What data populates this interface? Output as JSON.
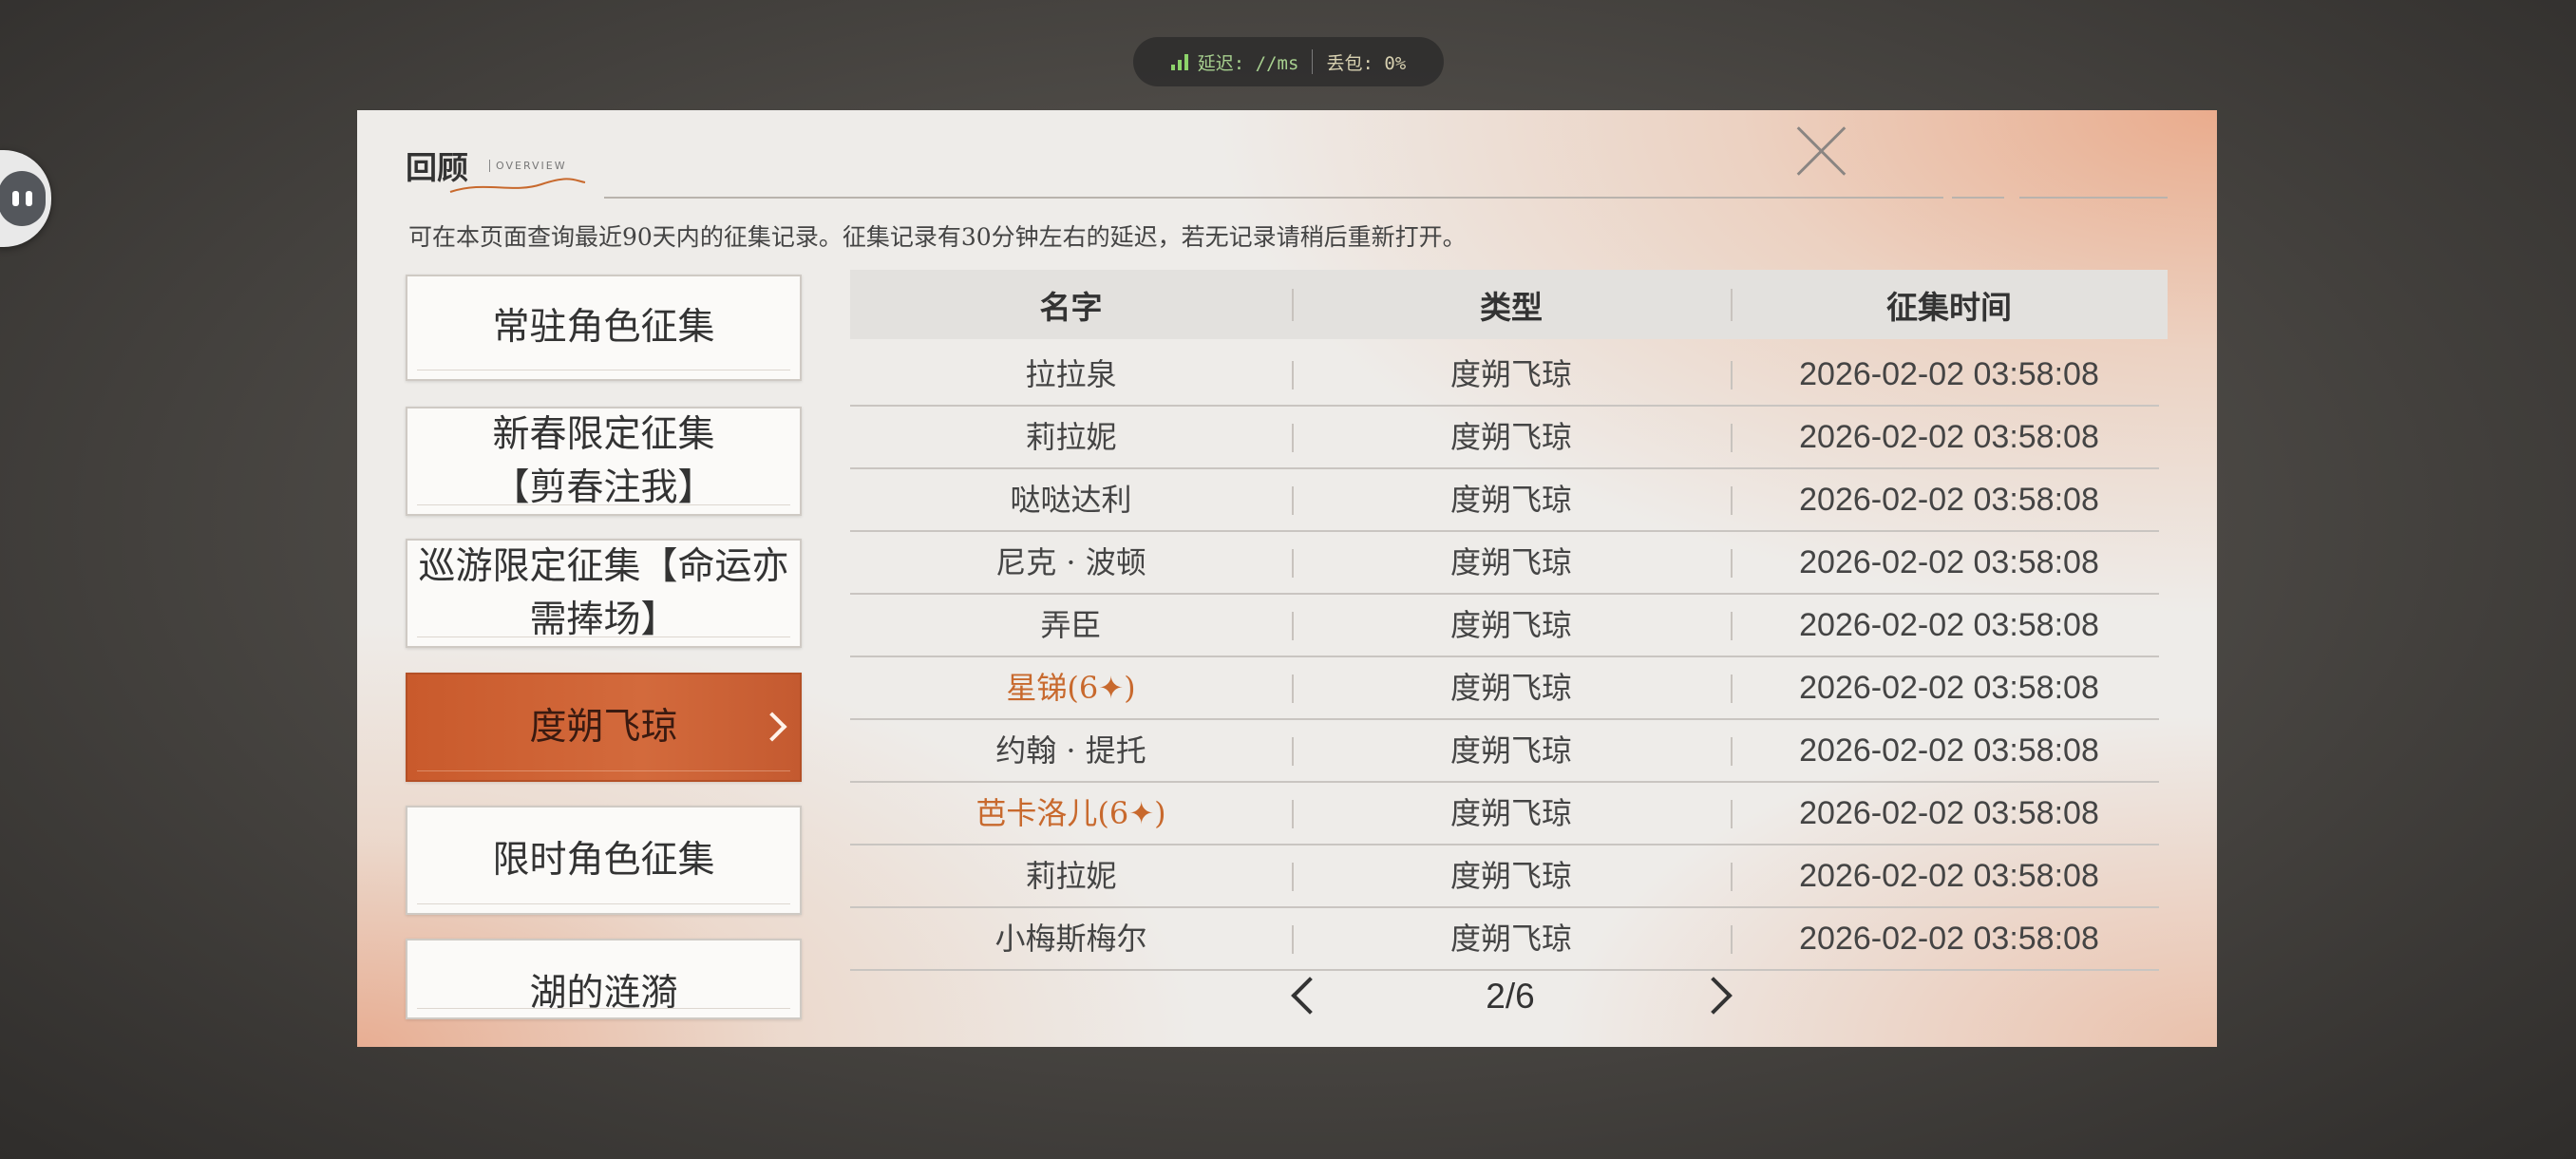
{
  "status_bar": {
    "latency_label": "延迟: //ms",
    "loss_label": "丢包: 0%"
  },
  "panel": {
    "title": "回顾",
    "subtitle": "OVERVIEW",
    "description": "可在本页面查询最近90天内的征集记录。征集记录有30分钟左右的延迟，若无记录请稍后重新打开。"
  },
  "sidebar": {
    "items": [
      {
        "label": "常驻角色征集"
      },
      {
        "label": "新春限定征集【剪春注我】"
      },
      {
        "label": "巡游限定征集【命运亦需捧场】"
      },
      {
        "label": "度朔飞琼"
      },
      {
        "label": "限时角色征集"
      },
      {
        "label": "湖的涟漪"
      }
    ],
    "active_index": 3
  },
  "table": {
    "headers": [
      "名字",
      "类型",
      "征集时间"
    ],
    "rows": [
      {
        "name": "拉拉泉",
        "type": "度朔飞琼",
        "time": "2026-02-02 03:58:08",
        "rare": false
      },
      {
        "name": "莉拉妮",
        "type": "度朔飞琼",
        "time": "2026-02-02 03:58:08",
        "rare": false
      },
      {
        "name": "哒哒达利",
        "type": "度朔飞琼",
        "time": "2026-02-02 03:58:08",
        "rare": false
      },
      {
        "name": "尼克 · 波顿",
        "type": "度朔飞琼",
        "time": "2026-02-02 03:58:08",
        "rare": false
      },
      {
        "name": "弄臣",
        "type": "度朔飞琼",
        "time": "2026-02-02 03:58:08",
        "rare": false
      },
      {
        "name": "星锑(6✦)",
        "type": "度朔飞琼",
        "time": "2026-02-02 03:58:08",
        "rare": true
      },
      {
        "name": "约翰 · 提托",
        "type": "度朔飞琼",
        "time": "2026-02-02 03:58:08",
        "rare": false
      },
      {
        "name": "芭卡洛儿(6✦)",
        "type": "度朔飞琼",
        "time": "2026-02-02 03:58:08",
        "rare": true
      },
      {
        "name": "莉拉妮",
        "type": "度朔飞琼",
        "time": "2026-02-02 03:58:08",
        "rare": false
      },
      {
        "name": "小梅斯梅尔",
        "type": "度朔飞琼",
        "time": "2026-02-02 03:58:08",
        "rare": false
      }
    ]
  },
  "pagination": {
    "page_text": "2/6"
  },
  "colors": {
    "accent": "#c95a2c",
    "rare_text": "#c8692d"
  }
}
